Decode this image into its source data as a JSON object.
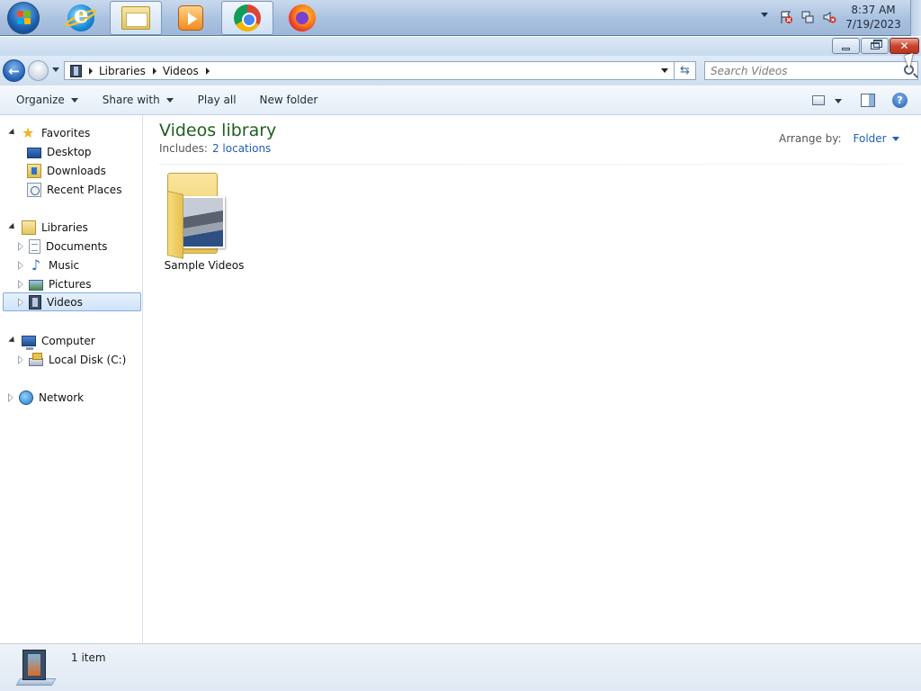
{
  "taskbar": {
    "apps": [
      {
        "name": "Internet Explorer",
        "icon": "ie-icon"
      },
      {
        "name": "Windows Explorer",
        "icon": "folder-icon",
        "active": true
      },
      {
        "name": "Windows Media Player",
        "icon": "media-player-icon"
      },
      {
        "name": "Google Chrome",
        "icon": "chrome-icon"
      },
      {
        "name": "Firefox",
        "icon": "firefox-icon"
      }
    ],
    "clock": {
      "time": "8:37 AM",
      "date": "7/19/2023"
    }
  },
  "address_bar": {
    "crumbs": [
      "Libraries",
      "Videos"
    ],
    "search_placeholder": "Search Videos"
  },
  "toolbar": {
    "organize": "Organize",
    "share_with": "Share with",
    "play_all": "Play all",
    "new_folder": "New folder"
  },
  "nav": {
    "favorites": {
      "label": "Favorites",
      "items": [
        "Desktop",
        "Downloads",
        "Recent Places"
      ]
    },
    "libraries": {
      "label": "Libraries",
      "items": [
        "Documents",
        "Music",
        "Pictures",
        "Videos"
      ],
      "selected": "Videos"
    },
    "computer": {
      "label": "Computer",
      "items": [
        "Local Disk (C:)"
      ]
    },
    "network": {
      "label": "Network"
    }
  },
  "content": {
    "title": "Videos library",
    "includes_label": "Includes:",
    "includes_link": "2 locations",
    "arrange_label": "Arrange by:",
    "arrange_value": "Folder",
    "items": [
      {
        "name": "Sample Videos",
        "type": "folder"
      }
    ]
  },
  "status": {
    "count": "1 item"
  },
  "colors": {
    "title_green": "#1e5f1e",
    "link_blue": "#1f5fb4",
    "close_red": "#c8452e"
  }
}
